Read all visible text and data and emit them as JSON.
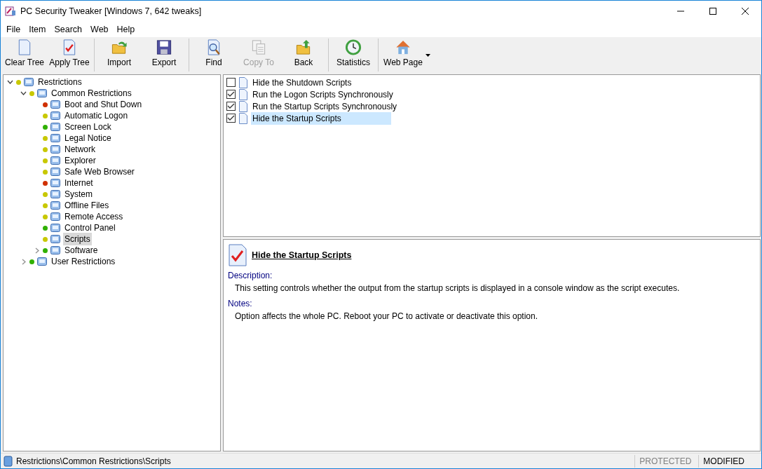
{
  "window": {
    "title": "PC Security Tweaker [Windows 7, 642 tweaks]"
  },
  "menu": [
    "File",
    "Item",
    "Search",
    "Web",
    "Help"
  ],
  "toolbar": [
    [
      {
        "label": "Clear Tree",
        "disabled": false,
        "dropdown": false
      },
      {
        "label": "Apply Tree",
        "disabled": false,
        "dropdown": false
      }
    ],
    [
      {
        "label": "Import",
        "disabled": false,
        "dropdown": false
      },
      {
        "label": "Export",
        "disabled": false,
        "dropdown": false
      }
    ],
    [
      {
        "label": "Find",
        "disabled": false,
        "dropdown": false
      },
      {
        "label": "Copy To",
        "disabled": true,
        "dropdown": false
      },
      {
        "label": "Back",
        "disabled": false,
        "dropdown": false
      }
    ],
    [
      {
        "label": "Statistics",
        "disabled": false,
        "dropdown": false
      }
    ],
    [
      {
        "label": "Web Page",
        "disabled": false,
        "dropdown": true
      }
    ]
  ],
  "tree": [
    {
      "label": "Restrictions",
      "color": "#c8c800",
      "selected": false,
      "expanded": true,
      "children": [
        {
          "label": "Common Restrictions",
          "color": "#c8c800",
          "selected": false,
          "expanded": true,
          "children": [
            {
              "label": "Boot and Shut Down",
              "color": "#d03000",
              "selected": false
            },
            {
              "label": "Automatic Logon",
              "color": "#c8c800",
              "selected": false
            },
            {
              "label": "Screen Lock",
              "color": "#30b000",
              "selected": false
            },
            {
              "label": "Legal Notice",
              "color": "#c8c800",
              "selected": false
            },
            {
              "label": "Network",
              "color": "#c8c800",
              "selected": false
            },
            {
              "label": "Explorer",
              "color": "#c8c800",
              "selected": false
            },
            {
              "label": "Safe Web Browser",
              "color": "#c8c800",
              "selected": false
            },
            {
              "label": "Internet",
              "color": "#d03000",
              "selected": false
            },
            {
              "label": "System",
              "color": "#c8c800",
              "selected": false
            },
            {
              "label": "Offline Files",
              "color": "#c8c800",
              "selected": false
            },
            {
              "label": "Remote Access",
              "color": "#c8c800",
              "selected": false
            },
            {
              "label": "Control Panel",
              "color": "#30b000",
              "selected": false
            },
            {
              "label": "Scripts",
              "color": "#c8c800",
              "selected": true
            },
            {
              "label": "Software",
              "color": "#30b000",
              "selected": false,
              "expanded": false
            }
          ]
        },
        {
          "label": "User Restrictions",
          "color": "#30b000",
          "selected": false,
          "expanded": false
        }
      ]
    }
  ],
  "tweaks": [
    {
      "label": "Hide the Shutdown Scripts",
      "checked": false,
      "selected": false
    },
    {
      "label": "Run the Logon Scripts Synchronously",
      "checked": true,
      "selected": false
    },
    {
      "label": "Run the Startup Scripts Synchronously",
      "checked": true,
      "selected": false
    },
    {
      "label": "Hide the Startup Scripts",
      "checked": true,
      "selected": true
    }
  ],
  "details": {
    "title": "Hide the Startup Scripts",
    "sections": [
      {
        "heading": "Description:",
        "text": "This setting controls whether the output from the startup scripts is displayed in a console window as the script executes."
      },
      {
        "heading": "Notes:",
        "text": "Option affects the whole PC. Reboot your PC to activate or deactivate this option."
      }
    ]
  },
  "status_bar": {
    "path": "Restrictions\\Common Restrictions\\Scripts",
    "indicators": [
      {
        "label": "PROTECTED",
        "on": false
      },
      {
        "label": "MODIFIED",
        "on": true
      }
    ]
  }
}
